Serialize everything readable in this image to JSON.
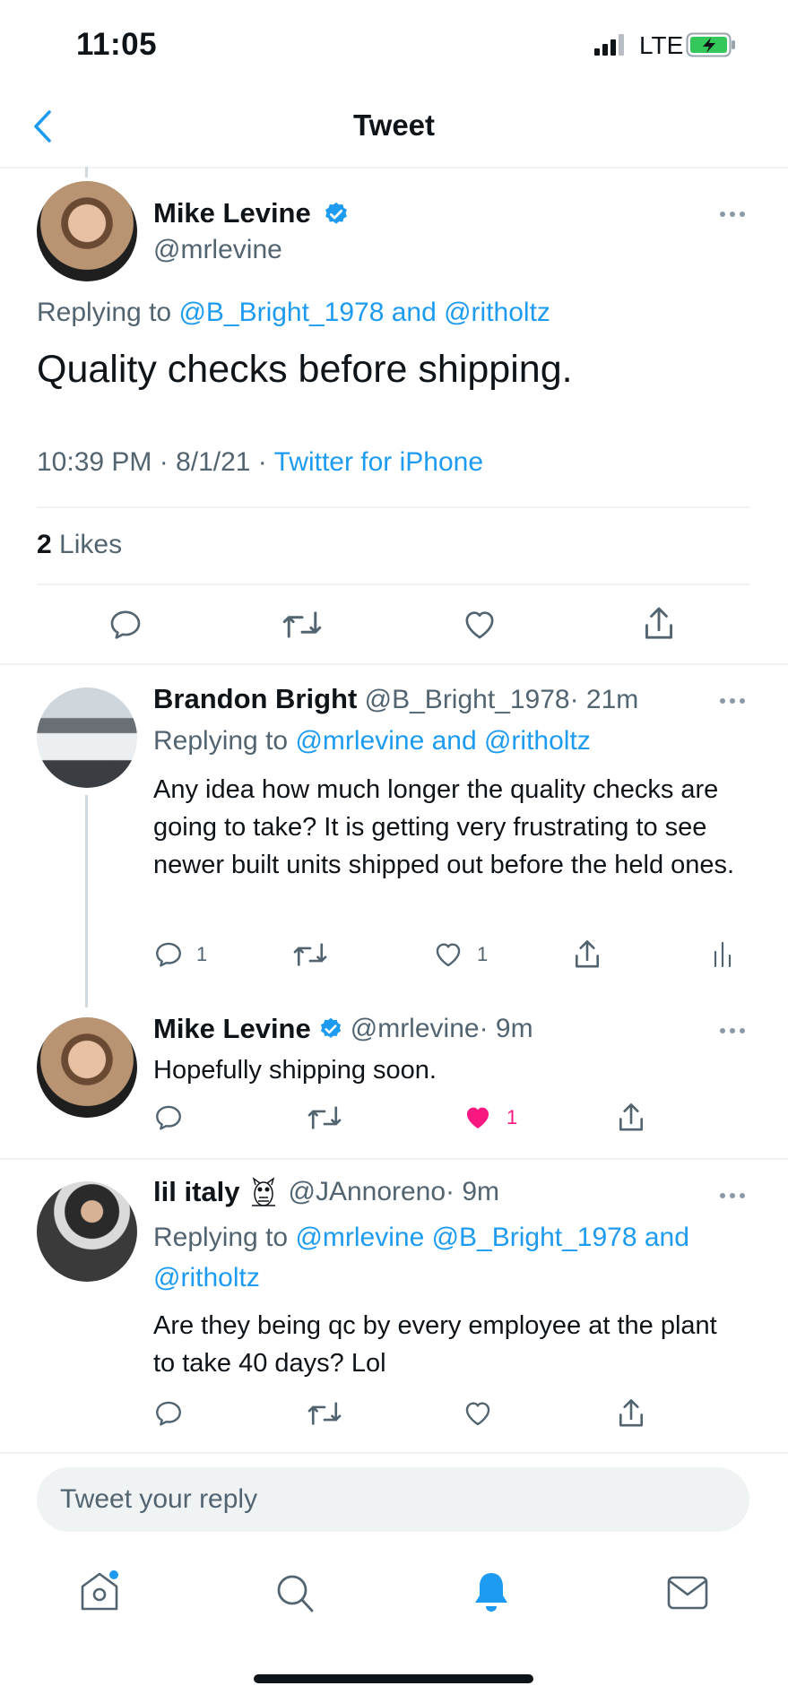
{
  "status_bar": {
    "time": "11:05",
    "network": "LTE"
  },
  "nav": {
    "title": "Tweet",
    "back_icon": "chevron-left-icon"
  },
  "main_tweet": {
    "author_name": "Mike Levine",
    "author_handle": "@mrlevine",
    "verified": true,
    "replying_prefix": "Replying to",
    "replying_targets": "@B_Bright_1978 and @ritholtz",
    "text": "Quality checks before shipping.",
    "timestamp": "10:39 PM · 8/1/21 · ",
    "source": "Twitter for iPhone",
    "likes_count": "2",
    "likes_label": "Likes"
  },
  "replies": [
    {
      "author_name": "Brandon Bright",
      "author_handle": "@B_Bright_1978",
      "time": "· 21m",
      "replying_prefix": "Replying to",
      "replying_targets": "@mrlevine and @ritholtz",
      "text": "Any idea how much longer the quality checks are going to take?  It is getting very frustrating to see newer built units shipped out before the held ones.",
      "reply_count": "1",
      "like_count": "1"
    },
    {
      "author_name": "Mike Levine",
      "author_handle": "@mrlevine",
      "time": "· 9m",
      "verified": true,
      "text": "Hopefully shipping soon.",
      "like_count": "1",
      "liked": true
    },
    {
      "author_name": "lil italy",
      "author_handle": "@JAnnoreno",
      "time": "· 9m",
      "name_emoji": "owl-icon",
      "replying_prefix": "Replying to",
      "replying_targets": "@mrlevine @B_Bright_1978 and @ritholtz",
      "text": "Are they being qc by every employee at the plant to take 40 days? Lol"
    }
  ],
  "reply_box": {
    "placeholder": "Tweet your reply"
  },
  "tab_bar": {
    "items": [
      "home-icon",
      "search-icon",
      "notifications-icon",
      "messages-icon"
    ],
    "active": "notifications-icon"
  },
  "colors": {
    "accent": "#1d9bf0",
    "like": "#f91880",
    "text": "#0f1419",
    "secondary": "#536471"
  }
}
